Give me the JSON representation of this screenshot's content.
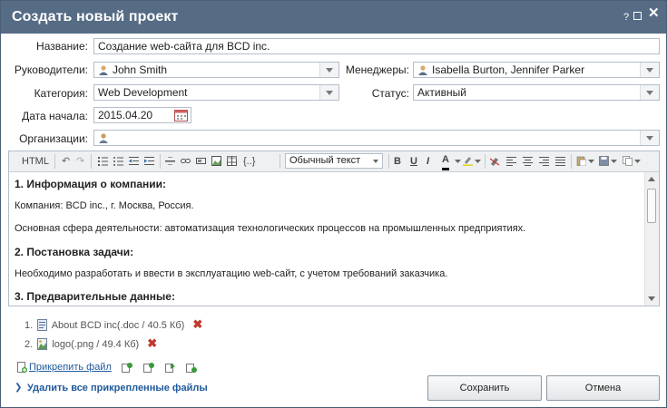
{
  "dialog": {
    "title": "Создать новый проект",
    "help_icon": "?"
  },
  "form": {
    "name_label": "Название:",
    "name_value": "Создание web-сайта для BCD inc.",
    "managers_label": "Руководители:",
    "managers_value": "John Smith",
    "members_label": "Менеджеры:",
    "members_value": "Isabella Burton, Jennifer Parker",
    "category_label": "Категория:",
    "category_value": "Web Development",
    "status_label": "Статус:",
    "status_value": "Активный",
    "start_date_label": "Дата начала:",
    "start_date_value": "2015.04.20",
    "organizations_label": "Организации:",
    "organizations_value": ""
  },
  "editor": {
    "html_label": "HTML",
    "braces_label": "{..}",
    "format_value": "Обычный текст",
    "bold_label": "B",
    "underline_label": "U",
    "italic_label": "I",
    "font_color_label": "A",
    "content": [
      {
        "text": "1. Информация о компании:",
        "heading": true
      },
      {
        "text": "Компания: BCD inc., г. Москва, Россия.",
        "heading": false
      },
      {
        "text": "Основная сфера деятельности: автоматизация технологических процессов на промышленных предприятиях.",
        "heading": false
      },
      {
        "text": "2. Постановка задачи:",
        "heading": true
      },
      {
        "text": "Необходимо разработать и ввести в эксплуатацию web-сайт, с учетом требований заказчика.",
        "heading": false
      },
      {
        "text": "3. Предварительные данные:",
        "heading": true
      }
    ]
  },
  "attachments": {
    "files": [
      {
        "index": "1.",
        "name": "About BCD inc(.doc / 40.5 Кб)"
      },
      {
        "index": "2.",
        "name": "logo(.png / 49.4 Кб)"
      }
    ],
    "attach_link": "Прикрепить файл",
    "delete_all_link": "Удалить все прикрепленные файлы"
  },
  "buttons": {
    "save": "Сохранить",
    "cancel": "Отмена"
  },
  "colors": {
    "titlebar": "#566c85",
    "link": "#1f5a9b",
    "delete": "#c0392b"
  }
}
